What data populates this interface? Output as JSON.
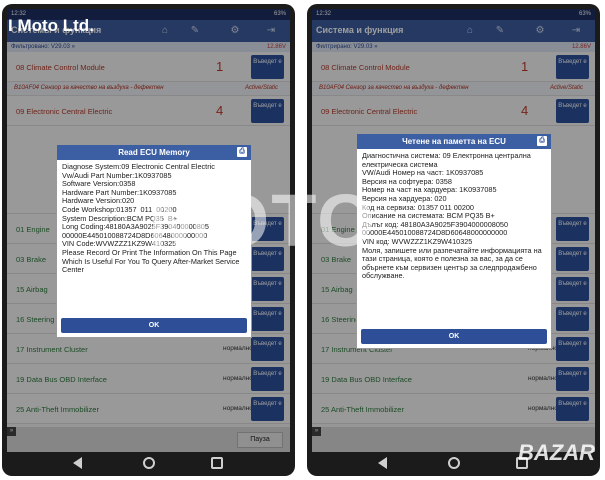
{
  "left": {
    "status_time": "12:32",
    "status_right": "63%",
    "header_title": "Системы и функция",
    "subbar_left": "Фильтровано: V29.03 »",
    "subbar_right": "12.86V",
    "rows": [
      {
        "name": "08 Climate Control Module",
        "count": "1",
        "button": "Въведет е",
        "sub_code": "B10AF04 Сензор за качество на въздуха - дефектен",
        "sub_state": "Active/Static"
      },
      {
        "name": "09 Electronic Central Electric",
        "count": "4",
        "button": "Въведет е"
      },
      {
        "name": "01 Engine",
        "button": "Въведет е"
      },
      {
        "name": "03 Brake",
        "button": "Въведет е"
      },
      {
        "name": "15 Airbag",
        "button": "Въведет е"
      },
      {
        "name": "16 Steering",
        "button": "Въведет е"
      },
      {
        "name": "17 Instrument Cluster",
        "status": "нормално",
        "button": "Въведет е"
      },
      {
        "name": "19 Data Bus OBD Interface",
        "status": "нормално",
        "button": "Въведет е"
      },
      {
        "name": "25 Anti-Theft Immobilizer",
        "status": "нормално",
        "button": "Въведет е"
      }
    ],
    "pause_label": "Пауза",
    "dialog": {
      "title": "Read ECU Memory",
      "body": "Diagnose System:09 Electronic Central Electric\nVw/Audi Part Number:1K0937085\nSoftware Version:0358\nHardware Part Number:1K0937085\nHardware Version:020\nCode Workshop:01357  011  00200\nSystem Description:BCM PQ35  B+\nLong Coding:48180A3A9025F390400000805\n00000E445010088724D8D60648000000000\nVIN Code:WVWZZZ1KZ9W410325\nPlease Record Or Print The Information On This Page Which Is Useful For You To Query After-Market Service Center",
      "ok": "OK"
    }
  },
  "right": {
    "status_time": "12:32",
    "status_right": "63%",
    "header_title": "Система и функция",
    "subbar_left": "Филтрирано: V29.03 »",
    "subbar_right": "12.86V",
    "rows": [
      {
        "name": "08 Climate Control Module",
        "count": "1",
        "button": "Въведет е",
        "sub_code": "B10AF04 Сензор за качество на въздуха - дефектен",
        "sub_state": "Active/Static"
      },
      {
        "name": "09 Electronic Central Electric",
        "count": "4",
        "button": "Въведет е"
      },
      {
        "name": "01 Engine",
        "button": "Въведет е"
      },
      {
        "name": "03 Brake",
        "button": "Въведет е"
      },
      {
        "name": "15 Airbag",
        "button": "Въведет е"
      },
      {
        "name": "16 Steering",
        "button": "Въведет е"
      },
      {
        "name": "17 Instrument Cluster",
        "status": "нормално",
        "button": "Въведет е"
      },
      {
        "name": "19 Data Bus OBD Interface",
        "status": "нормално",
        "button": "Въведет е"
      },
      {
        "name": "25 Anti-Theft Immobilizer",
        "status": "нормално",
        "button": "Въведет е"
      }
    ],
    "dialog": {
      "title": "Четене на паметта на ECU",
      "body": "Диагностична система: 09 Електронна централна електрическа система\nVW/Audi Номер на част: 1K0937085\nВерсия на софтуера: 0358\nНомер на част на хардуера: 1K0937085\nВерсия на хардуера: 020\nКод на сервиза: 01357 011 00200\nОписание на системата: BCM PQ35 B+\nДълъг код: 48180A3A9025F3904000008050\n00000E445010088724D8D60648000000000\nVIN код: WVWZZZ1KZ9W410325\nМоля, запишете или разпечатайте информацията на тази страница, която е полезна за вас, за да се обърнете към сервизен център за следпродажбено обслужване.",
      "ok": "OK"
    }
  },
  "overlay": {
    "brand": "I Moto Ltd.",
    "watermark": "MOTO",
    "bazar": "BAZAR"
  }
}
